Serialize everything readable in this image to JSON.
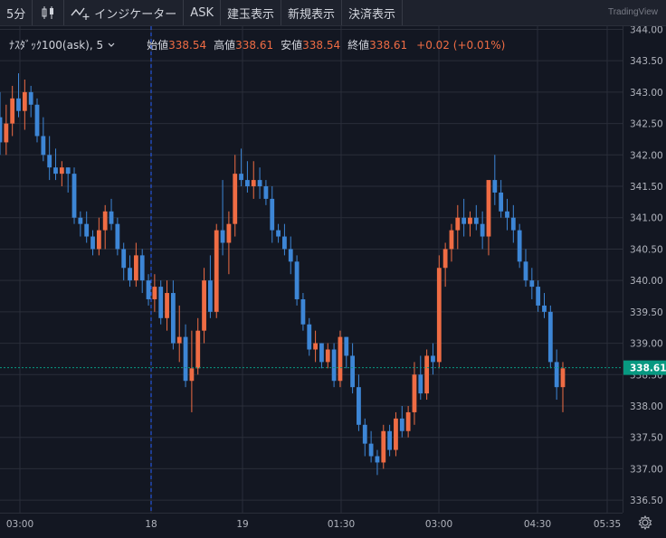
{
  "toolbar": {
    "interval": "5分",
    "indicators": "インジケーター",
    "ask": "ASK",
    "positions": "建玉表示",
    "new_order": "新規表示",
    "settlement": "決済表示",
    "brand": "TradingView"
  },
  "legend": {
    "symbol": "ﾅｽﾀﾞｯｸ100(ask)",
    "interval": "5",
    "open_label": "始値",
    "open": "338.54",
    "high_label": "高値",
    "high": "338.61",
    "low_label": "安値",
    "low": "338.54",
    "close_label": "終値",
    "close": "338.61",
    "change": "+0.02 (+0.01%)"
  },
  "price_badge": "338.61",
  "colors": {
    "up": "#ef6c44",
    "down": "#3d86d6",
    "bg": "#131722",
    "grid": "#2a2e39",
    "badge": "#089981"
  },
  "chart_data": {
    "type": "candlestick",
    "y_ticks": [
      "344.00",
      "343.50",
      "343.00",
      "342.50",
      "342.00",
      "341.50",
      "341.00",
      "340.50",
      "340.00",
      "339.50",
      "339.00",
      "338.50",
      "338.00",
      "337.50",
      "337.00",
      "336.50"
    ],
    "x_ticks": [
      "03:00",
      "18",
      "19",
      "01:30",
      "03:00",
      "04:30",
      "05:35"
    ],
    "ylim": [
      336.3,
      344.05
    ],
    "last_price": 338.61,
    "candles": [
      [
        342.6,
        343.0,
        342.0,
        342.2
      ],
      [
        342.2,
        342.8,
        342.0,
        342.5
      ],
      [
        342.5,
        343.1,
        342.3,
        342.9
      ],
      [
        342.9,
        343.3,
        342.6,
        342.7
      ],
      [
        342.7,
        343.2,
        342.4,
        343.0
      ],
      [
        343.0,
        343.1,
        342.6,
        342.8
      ],
      [
        342.8,
        342.9,
        342.2,
        342.3
      ],
      [
        342.3,
        342.6,
        341.9,
        342.0
      ],
      [
        342.0,
        342.3,
        341.6,
        341.8
      ],
      [
        341.8,
        342.1,
        341.6,
        341.7
      ],
      [
        341.7,
        341.9,
        341.5,
        341.8
      ],
      [
        341.8,
        341.8,
        341.4,
        341.7
      ],
      [
        341.7,
        341.8,
        340.9,
        341.0
      ],
      [
        341.0,
        341.1,
        340.7,
        340.9
      ],
      [
        340.9,
        341.1,
        340.6,
        340.7
      ],
      [
        340.7,
        340.8,
        340.4,
        340.5
      ],
      [
        340.5,
        341.0,
        340.4,
        340.8
      ],
      [
        340.8,
        341.2,
        340.5,
        341.1
      ],
      [
        341.1,
        341.3,
        340.8,
        340.9
      ],
      [
        340.9,
        341.0,
        340.4,
        340.5
      ],
      [
        340.5,
        340.6,
        340.0,
        340.2
      ],
      [
        340.2,
        340.4,
        339.9,
        340.0
      ],
      [
        340.0,
        340.6,
        339.9,
        340.4
      ],
      [
        340.4,
        340.5,
        339.8,
        340.0
      ],
      [
        340.0,
        340.1,
        339.6,
        339.7
      ],
      [
        339.7,
        340.1,
        339.5,
        339.9
      ],
      [
        339.9,
        340.0,
        339.3,
        339.4
      ],
      [
        339.4,
        340.0,
        339.2,
        339.8
      ],
      [
        339.8,
        340.0,
        338.9,
        339.0
      ],
      [
        339.0,
        339.6,
        338.7,
        339.1
      ],
      [
        339.1,
        339.3,
        338.3,
        338.4
      ],
      [
        338.4,
        339.2,
        337.9,
        338.6
      ],
      [
        338.6,
        339.4,
        338.5,
        339.2
      ],
      [
        339.2,
        340.2,
        339.0,
        340.0
      ],
      [
        340.0,
        340.4,
        339.4,
        339.5
      ],
      [
        339.5,
        340.9,
        339.4,
        340.8
      ],
      [
        340.8,
        341.6,
        340.4,
        340.6
      ],
      [
        340.6,
        341.1,
        340.1,
        340.9
      ],
      [
        340.9,
        342.0,
        340.7,
        341.7
      ],
      [
        341.7,
        342.1,
        341.5,
        341.6
      ],
      [
        341.6,
        341.9,
        341.4,
        341.5
      ],
      [
        341.5,
        341.9,
        341.3,
        341.6
      ],
      [
        341.6,
        341.8,
        341.3,
        341.5
      ],
      [
        341.5,
        341.6,
        341.2,
        341.3
      ],
      [
        341.3,
        341.5,
        340.6,
        340.8
      ],
      [
        340.8,
        340.9,
        340.6,
        340.7
      ],
      [
        340.7,
        340.9,
        340.4,
        340.5
      ],
      [
        340.5,
        340.7,
        340.1,
        340.3
      ],
      [
        340.3,
        340.4,
        339.6,
        339.7
      ],
      [
        339.7,
        339.8,
        339.2,
        339.3
      ],
      [
        339.3,
        339.4,
        338.8,
        338.9
      ],
      [
        338.9,
        339.2,
        338.7,
        339.0
      ],
      [
        339.0,
        339.0,
        338.6,
        338.7
      ],
      [
        338.7,
        339.0,
        338.6,
        338.9
      ],
      [
        338.9,
        339.0,
        338.3,
        338.4
      ],
      [
        338.4,
        339.2,
        338.3,
        339.1
      ],
      [
        339.1,
        339.1,
        338.6,
        338.8
      ],
      [
        338.8,
        339.0,
        338.2,
        338.3
      ],
      [
        338.3,
        338.5,
        337.6,
        337.7
      ],
      [
        337.7,
        337.8,
        337.2,
        337.4
      ],
      [
        337.4,
        337.6,
        337.1,
        337.2
      ],
      [
        337.2,
        337.3,
        336.9,
        337.1
      ],
      [
        337.1,
        337.7,
        337.0,
        337.6
      ],
      [
        337.6,
        337.7,
        337.2,
        337.3
      ],
      [
        337.3,
        337.9,
        337.2,
        337.8
      ],
      [
        337.8,
        338.0,
        337.5,
        337.6
      ],
      [
        337.6,
        338.0,
        337.5,
        337.9
      ],
      [
        337.9,
        338.7,
        337.7,
        338.5
      ],
      [
        338.5,
        338.8,
        338.1,
        338.2
      ],
      [
        338.2,
        338.9,
        338.1,
        338.8
      ],
      [
        338.8,
        339.0,
        338.5,
        338.7
      ],
      [
        338.7,
        340.4,
        338.6,
        340.2
      ],
      [
        340.2,
        340.6,
        339.9,
        340.5
      ],
      [
        340.5,
        340.9,
        340.3,
        340.8
      ],
      [
        340.8,
        341.2,
        340.5,
        341.0
      ],
      [
        341.0,
        341.3,
        340.7,
        340.9
      ],
      [
        340.9,
        341.1,
        340.7,
        341.0
      ],
      [
        341.0,
        341.2,
        340.8,
        340.9
      ],
      [
        340.9,
        341.1,
        340.5,
        340.7
      ],
      [
        340.7,
        341.2,
        340.4,
        341.6
      ],
      [
        341.6,
        342.0,
        341.2,
        341.4
      ],
      [
        341.4,
        341.6,
        341.0,
        341.1
      ],
      [
        341.1,
        341.3,
        340.8,
        341.0
      ],
      [
        341.0,
        341.2,
        340.6,
        340.8
      ],
      [
        340.8,
        340.9,
        340.2,
        340.3
      ],
      [
        340.3,
        340.5,
        339.9,
        340.0
      ],
      [
        340.0,
        340.2,
        339.7,
        339.9
      ],
      [
        339.9,
        340.0,
        339.5,
        339.6
      ],
      [
        339.6,
        339.8,
        339.4,
        339.5
      ],
      [
        339.5,
        339.6,
        338.6,
        338.7
      ],
      [
        338.7,
        338.9,
        338.1,
        338.3
      ],
      [
        338.3,
        338.7,
        337.9,
        338.6
      ]
    ]
  }
}
